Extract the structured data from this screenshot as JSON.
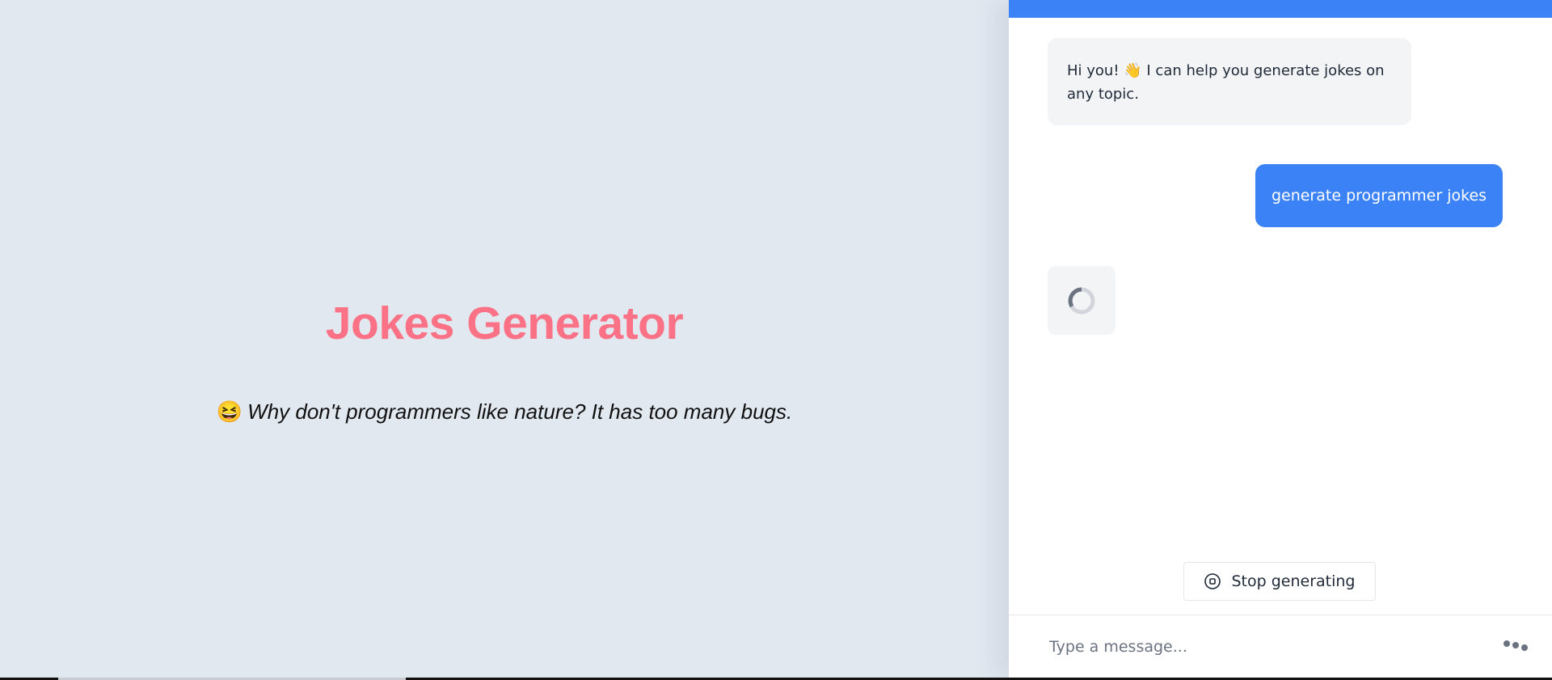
{
  "main": {
    "title": "Jokes Generator",
    "joke_emoji": "😆",
    "joke_text": "Why don't programmers like nature? It has too many bugs."
  },
  "chat": {
    "assistant_greeting": "Hi you! 👋 I can help you generate jokes on any topic.",
    "user_message": "generate programmer jokes",
    "stop_label": "Stop generating",
    "input_placeholder": "Type a message..."
  },
  "colors": {
    "accent": "#3b82f6",
    "title": "#fb7185",
    "background": "#e2e8f0"
  },
  "icons": {
    "stop": "stop-circle-icon",
    "more": "dots-icon",
    "loading": "spinner-icon"
  }
}
